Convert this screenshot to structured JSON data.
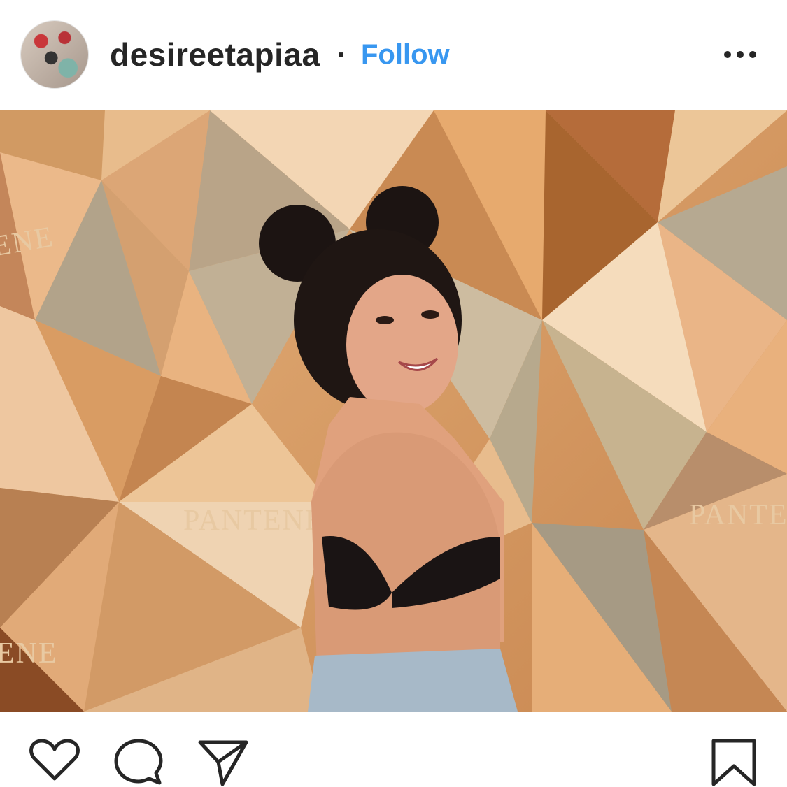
{
  "post": {
    "username": "desireetapiaa",
    "separator": "·",
    "follow_label": "Follow",
    "more_icon": "more-options-icon"
  },
  "photo": {
    "description_icon": "post-photo",
    "wall_brand_texts": [
      "ENE",
      "PANTENE",
      "PANTEN",
      "ENE"
    ]
  },
  "actions": {
    "icons": [
      "heart-icon",
      "comment-icon",
      "share-icon",
      "bookmark-icon"
    ]
  },
  "colors": {
    "follow_blue": "#3897f0",
    "text_dark": "#262626",
    "gold_light": "#f2cfa6",
    "gold_dark": "#b87845"
  }
}
